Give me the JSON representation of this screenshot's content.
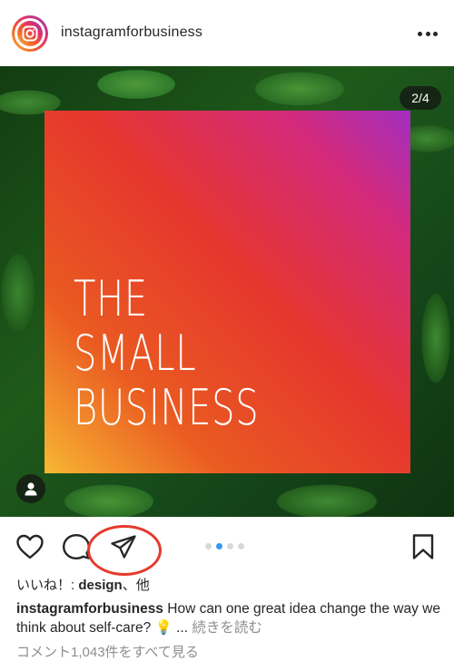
{
  "header": {
    "username": "instagramforbusiness"
  },
  "media": {
    "counter": "2/4",
    "graphic_lines": [
      "THE",
      "SMALL",
      "BUSINESS"
    ]
  },
  "carousel": {
    "dot_count": 4,
    "active_index": 1
  },
  "likes": {
    "prefix": "いいね！: ",
    "name": "design",
    "suffix": "、他"
  },
  "caption": {
    "username": "instagramforbusiness",
    "text": "How can one great idea change the way we think about self-care? 💡",
    "ellipsis": " ... ",
    "more_label": "続きを読む"
  },
  "comments": {
    "view_all": "コメント1,043件をすべて見る"
  },
  "colors": {
    "highlight": "#e53a2b",
    "active_dot": "#3897f0",
    "text": "#262626",
    "muted": "#8e8e8e"
  },
  "icons": {
    "profile": "instagram-logo-icon",
    "more": "more-options-icon",
    "user_tag": "user-tag-icon",
    "like": "heart-icon",
    "comment": "comment-icon",
    "share": "paper-plane-icon",
    "save": "bookmark-icon"
  }
}
